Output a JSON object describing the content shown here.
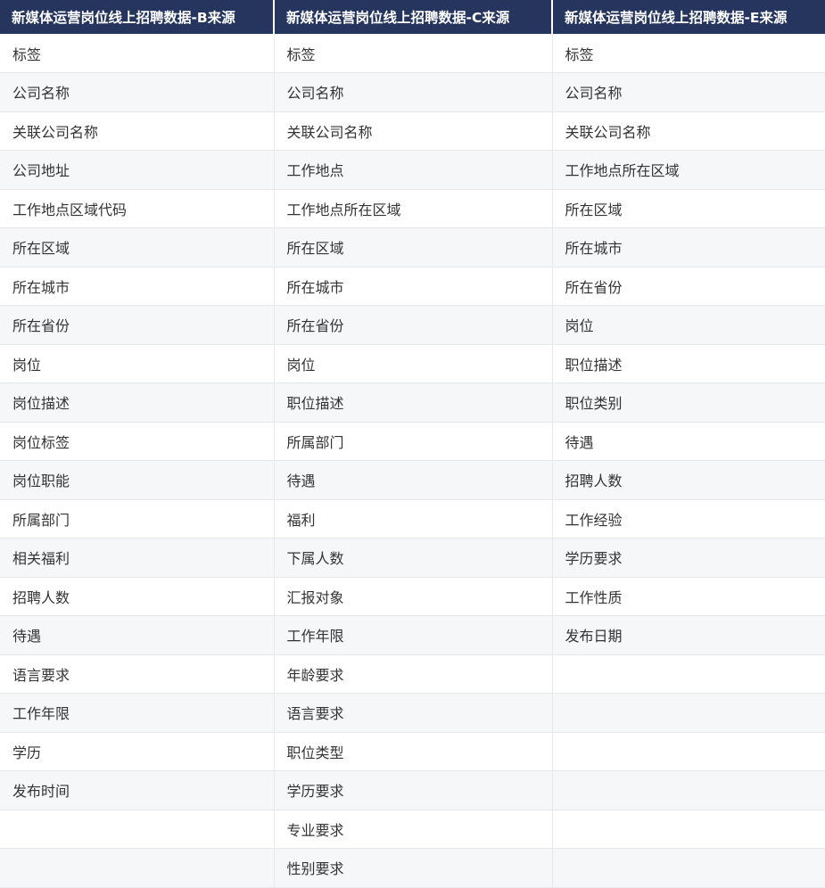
{
  "table": {
    "headers": [
      "新媒体运营岗位线上招聘数据-B来源",
      "新媒体运营岗位线上招聘数据-C来源",
      "新媒体运营岗位线上招聘数据-E来源"
    ],
    "rows": [
      [
        "标签",
        "标签",
        "标签"
      ],
      [
        "公司名称",
        "公司名称",
        "公司名称"
      ],
      [
        "关联公司名称",
        "关联公司名称",
        "关联公司名称"
      ],
      [
        "公司地址",
        "工作地点",
        "工作地点所在区域"
      ],
      [
        "工作地点区域代码",
        "工作地点所在区域",
        "所在区域"
      ],
      [
        "所在区域",
        "所在区域",
        "所在城市"
      ],
      [
        "所在城市",
        "所在城市",
        "所在省份"
      ],
      [
        "所在省份",
        "所在省份",
        "岗位"
      ],
      [
        "岗位",
        "岗位",
        "职位描述"
      ],
      [
        "岗位描述",
        "职位描述",
        "职位类别"
      ],
      [
        "岗位标签",
        "所属部门",
        "待遇"
      ],
      [
        "岗位职能",
        "待遇",
        "招聘人数"
      ],
      [
        "所属部门",
        "福利",
        "工作经验"
      ],
      [
        "相关福利",
        "下属人数",
        "学历要求"
      ],
      [
        "招聘人数",
        "汇报对象",
        "工作性质"
      ],
      [
        "待遇",
        "工作年限",
        "发布日期"
      ],
      [
        "语言要求",
        "年龄要求",
        ""
      ],
      [
        "工作年限",
        "语言要求",
        ""
      ],
      [
        "学历",
        "职位类型",
        ""
      ],
      [
        "发布时间",
        "学历要求",
        ""
      ],
      [
        "",
        "专业要求",
        ""
      ],
      [
        "",
        "性别要求",
        ""
      ]
    ]
  }
}
